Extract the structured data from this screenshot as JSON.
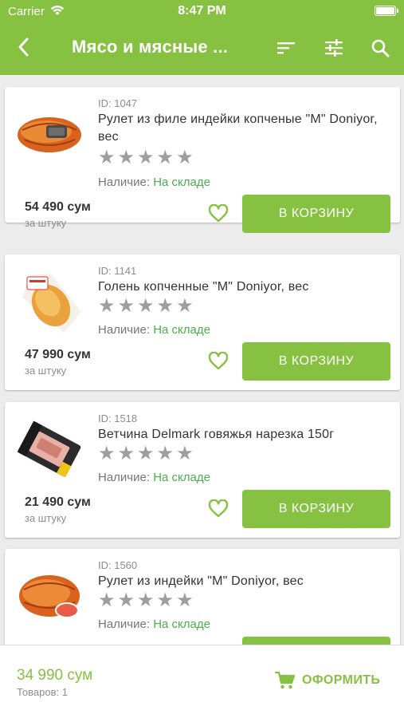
{
  "status_bar": {
    "carrier": "Carrier",
    "time": "8:47 PM"
  },
  "header": {
    "title": "Мясо и мясные ..."
  },
  "availability_label": "Наличие:",
  "add_to_cart_label": "В КОРЗИНУ",
  "products": [
    {
      "id_text": "ID: 1047",
      "name": "Рулет из филе индейки копченые \"М\" Doniyor, вес",
      "rating": 0,
      "stock_status": "На складе",
      "price": "54 490 сум",
      "unit": "за штуку"
    },
    {
      "id_text": "ID: 1141",
      "name": "Голень копченные \"М\" Doniyor, вес",
      "rating": 0,
      "stock_status": "На складе",
      "price": "47 990 сум",
      "unit": "за штуку"
    },
    {
      "id_text": "ID: 1518",
      "name": "Ветчина Delmark говяжья нарезка 150г",
      "rating": 0,
      "stock_status": "На складе",
      "price": "21 490 сум",
      "unit": "за штуку"
    },
    {
      "id_text": "ID: 1560",
      "name": "Рулет из индейки \"М\" Doniyor, вес",
      "rating": 0,
      "stock_status": "На складе",
      "price": "",
      "unit": ""
    }
  ],
  "cart_summary": {
    "total": "34 990 сум",
    "items_count": "Товаров: 1",
    "checkout_label": "ОФОРМИТЬ"
  },
  "colors": {
    "accent": "#86c142",
    "in_stock": "#4caf50",
    "star_empty": "#9e9e9e"
  }
}
